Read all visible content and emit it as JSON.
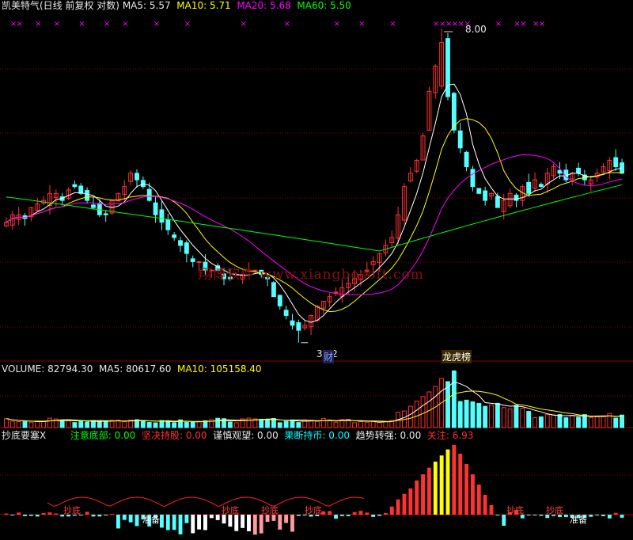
{
  "main_header": {
    "title": "凯美特气(日线 前复权 对数)",
    "ma5_label": "MA5: 5.57",
    "ma10_label": "MA10: 5.71",
    "ma20_label": "MA20: 5.68",
    "ma60_label": "MA60: 5.50"
  },
  "price_annotations": {
    "high": "8.00",
    "low": "3.62",
    "tag_cai": "财",
    "tag_longhu": "龙虎榜"
  },
  "watermark": "翔博软件 www.xiangbosoft.com",
  "volume_header": {
    "volume_label": "VOLUME: 82794.30",
    "ma5_label": "MA5: 80617.60",
    "ma10_label": "MA10: 105158.40"
  },
  "indicator_header": {
    "name": "抄底要塞X",
    "item1": "注意底部: 0.00",
    "item2": "坚决持股: 0.00",
    "item3": "谨慎观望: 0.00",
    "item4": "果断持币: 0.00",
    "item5": "趋势转强: 0.00",
    "item6": "关注: 6.93"
  },
  "indicator_markers": {
    "chaodi": "抄底",
    "zhunbei": "准备"
  },
  "colors": {
    "up": "#ff3232",
    "down": "#54ffff",
    "ma5": "#ffffff",
    "ma10": "#ffff00",
    "ma20": "#ff00ff",
    "ma60": "#00ff00",
    "grid": "#8b0000",
    "signal_x": "#ff00ff"
  },
  "chart_data": [
    {
      "type": "candlestick",
      "title": "凯美特气(日线 前复权 对数)",
      "y_scale": "log",
      "high_marker": 8.0,
      "low_marker": 3.62,
      "ma_latest": {
        "MA5": 5.57,
        "MA10": 5.71,
        "MA20": 5.68,
        "MA60": 5.5
      },
      "close_trend": [
        4.9,
        5.0,
        5.0,
        4.95,
        5.1,
        5.15,
        5.2,
        5.3,
        5.3,
        5.2,
        5.35,
        5.4,
        5.3,
        5.2,
        5.1,
        5.0,
        5.0,
        5.2,
        5.3,
        5.4,
        5.6,
        5.5,
        5.4,
        5.2,
        5.0,
        4.9,
        4.8,
        4.7,
        4.6,
        4.5,
        4.4,
        4.4,
        4.3,
        4.3,
        4.3,
        4.2,
        4.2,
        4.25,
        4.25,
        4.3,
        4.3,
        4.25,
        4.2,
        4.0,
        3.9,
        3.8,
        3.7,
        3.65,
        3.7,
        3.8,
        3.9,
        3.95,
        4.0,
        4.05,
        4.1,
        4.15,
        4.2,
        4.25,
        4.3,
        4.4,
        4.5,
        4.6,
        4.7,
        5.0,
        5.4,
        5.6,
        5.8,
        6.2,
        7.0,
        7.5,
        8.0,
        6.9,
        6.3,
        6.0,
        5.7,
        5.4,
        5.3,
        5.2,
        5.3,
        5.1,
        5.2,
        5.3,
        5.2,
        5.4,
        5.3,
        5.5,
        5.4,
        5.6,
        5.7,
        5.6,
        5.5,
        5.6,
        5.6,
        5.5,
        5.5,
        5.6,
        5.7,
        5.8,
        5.7,
        5.6
      ]
    },
    {
      "type": "bar",
      "title": "VOLUME",
      "latest": {
        "VOLUME": 82794.3,
        "MA5": 80617.6,
        "MA10": 105158.4
      }
    },
    {
      "type": "bar",
      "title": "抄底要塞X",
      "latest": {
        "注意底部": 0.0,
        "坚决持股": 0.0,
        "谨慎观望": 0.0,
        "果断持币": 0.0,
        "趋势转强": 0.0,
        "关注": 6.93
      }
    }
  ]
}
